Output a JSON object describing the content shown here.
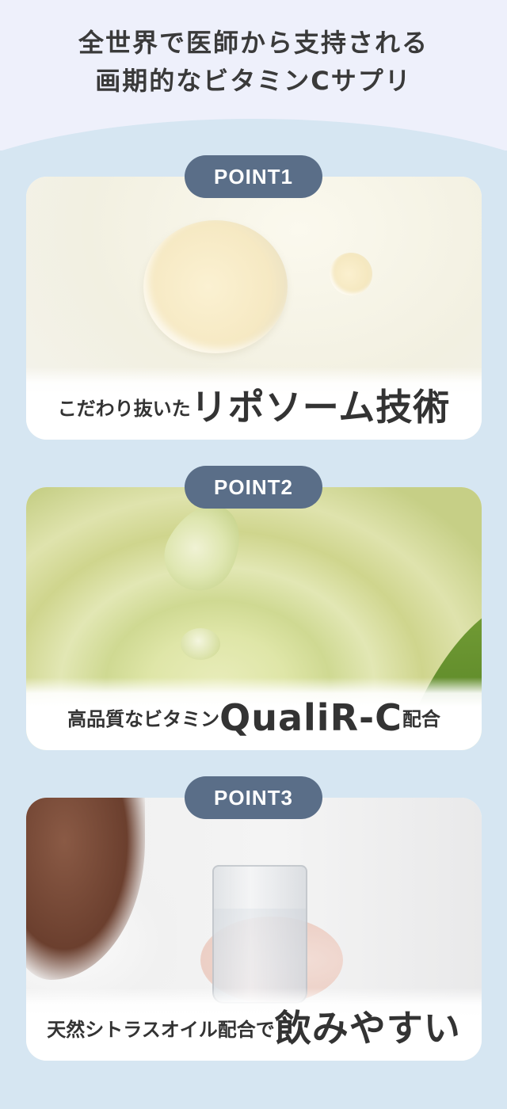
{
  "headline": {
    "line1": "全世界で医師から支持される",
    "line2": "画期的なビタミンCサプリ"
  },
  "points": [
    {
      "badge": "POINT1",
      "caption_small": "こだわり抜いた",
      "caption_big": "リポソーム技術"
    },
    {
      "badge": "POINT2",
      "caption_small": "高品質なビタミン",
      "caption_big": "QualiR-C",
      "caption_suffix": "配合"
    },
    {
      "badge": "POINT3",
      "caption_small": "天然シトラスオイル配合で",
      "caption_big": "飲みやすい"
    }
  ],
  "colors": {
    "background": "#d6e6f2",
    "top_band": "#eef0fb",
    "badge": "#5a6e88",
    "text": "#333333"
  }
}
